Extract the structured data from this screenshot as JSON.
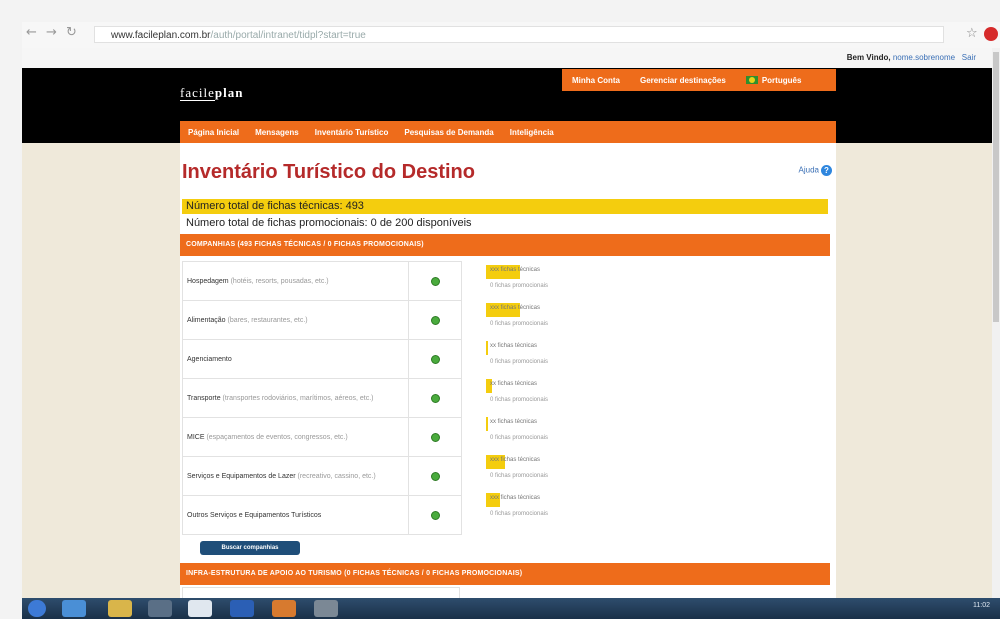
{
  "browser": {
    "url_host": "www.facileplan.com.br",
    "url_path": "/auth/portal/intranet/tidpl?start=true"
  },
  "header": {
    "welcome_label": "Bem Vindo,",
    "user_name": "nome.sobrenome",
    "exit_label": "Sair",
    "logo_text_light": "facile",
    "logo_text_bold": "plan",
    "tools": [
      "Minha Conta",
      "Gerenciar destinações",
      "Português"
    ]
  },
  "nav": {
    "items": [
      "Página Inicial",
      "Mensagens",
      "Inventário Turístico",
      "Pesquisas de Demanda",
      "Inteligência"
    ]
  },
  "page": {
    "title": "Inventário Turístico do Destino",
    "help_label": "Ajuda",
    "help_icon_glyph": "?",
    "total_tech": "Número total de fichas técnicas: 493",
    "total_promo": "Número total de fichas promocionais: 0 de 200 disponíveis",
    "section1_title": "COMPANHIAS (493 FICHAS TÉCNICAS / 0 FICHAS PROMOCIONAIS)",
    "section2_title": "INFRA-ESTRUTURA DE APOIO AO TURISMO (0 FICHAS TÉCNICAS / 0 FICHAS PROMOCIONAIS)",
    "search_button": "Buscar companhias"
  },
  "categories": [
    {
      "name": "Hospedagem",
      "examples": "(hotéis, resorts, pousadas, etc.)",
      "tech_label": "xxx fichas técnicas",
      "promo_label": "0 fichas promocionais",
      "fill_pct": 28
    },
    {
      "name": "Alimentação",
      "examples": "(bares, restaurantes, etc.)",
      "tech_label": "xxx fichas técnicas",
      "promo_label": "0 fichas promocionais",
      "fill_pct": 28
    },
    {
      "name": "Agenciamento",
      "examples": "",
      "tech_label": "xx fichas técnicas",
      "promo_label": "0 fichas promocionais",
      "fill_pct": 2
    },
    {
      "name": "Transporte",
      "examples": "(transportes rodoviários, marítimos, aéreos, etc.)",
      "tech_label": "xx fichas técnicas",
      "promo_label": "0 fichas promocionais",
      "fill_pct": 5
    },
    {
      "name": "MICE",
      "examples": "(espaçamentos de eventos, congressos, etc.)",
      "tech_label": "xx fichas técnicas",
      "promo_label": "0 fichas promocionais",
      "fill_pct": 2
    },
    {
      "name": "Serviços e Equipamentos de Lazer",
      "examples": "(recreativo, cassino, etc.)",
      "tech_label": "xxx fichas técnicas",
      "promo_label": "0 fichas promocionais",
      "fill_pct": 16
    },
    {
      "name": "Outros Serviços e Equipamentos Turísticos",
      "examples": "",
      "tech_label": "xxx fichas técnicas",
      "promo_label": "0 fichas promocionais",
      "fill_pct": 12
    }
  ],
  "taskbar": {
    "clock": "11:02"
  },
  "colors": {
    "accent_orange": "#ee6c1b",
    "highlight_yellow": "#f4cd0e",
    "title_red": "#b52a2a"
  }
}
